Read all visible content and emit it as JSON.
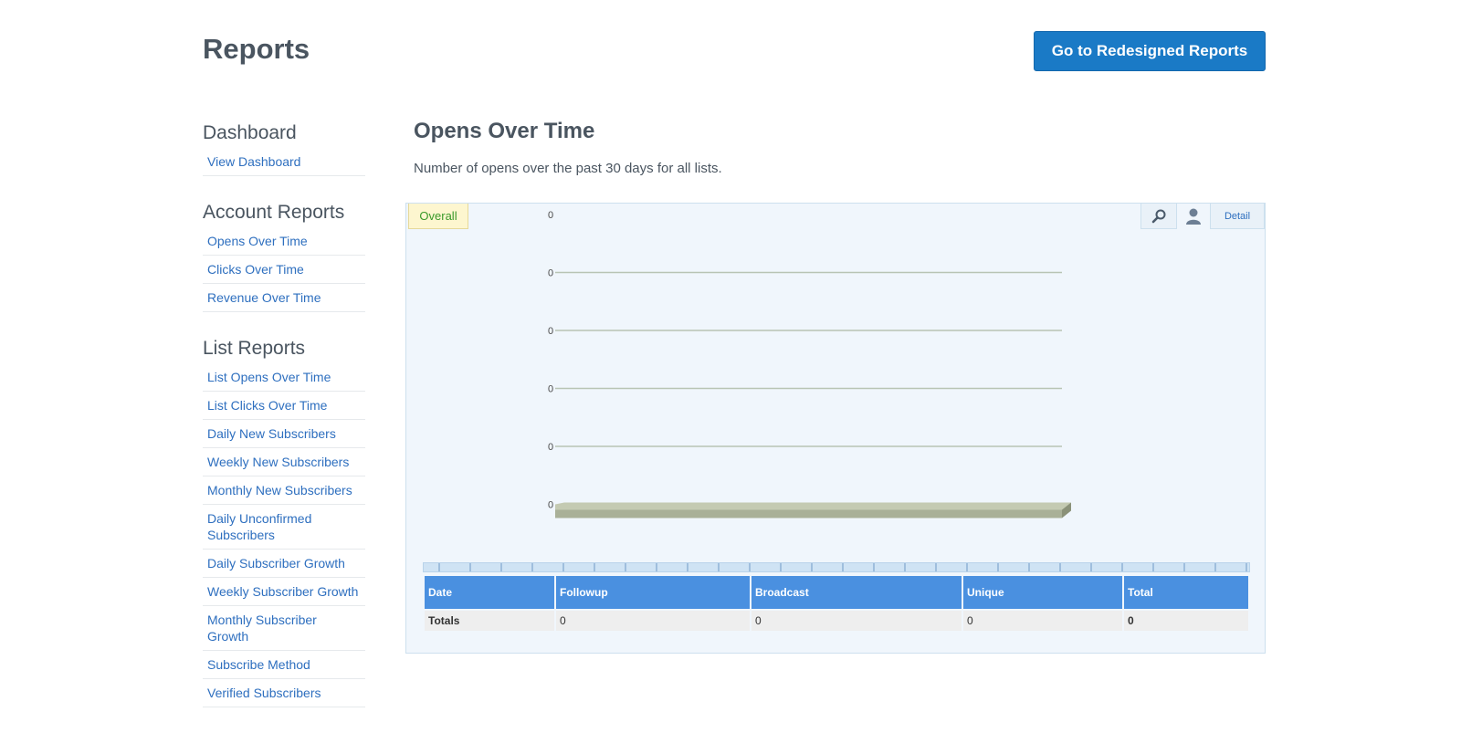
{
  "page": {
    "title": "Reports"
  },
  "header": {
    "redesign_button": "Go to Redesigned Reports"
  },
  "sidebar": {
    "sections": [
      {
        "heading": "Dashboard",
        "links": [
          "View Dashboard"
        ]
      },
      {
        "heading": "Account Reports",
        "links": [
          "Opens Over Time",
          "Clicks Over Time",
          "Revenue Over Time"
        ]
      },
      {
        "heading": "List Reports",
        "links": [
          "List Opens Over Time",
          "List Clicks Over Time",
          "Daily New Subscribers",
          "Weekly New Subscribers",
          "Monthly New Subscribers",
          "Daily Unconfirmed Subscribers",
          "Daily Subscriber Growth",
          "Weekly Subscriber Growth",
          "Monthly Subscriber Growth",
          "Subscribe Method",
          "Verified Subscribers"
        ]
      }
    ]
  },
  "main": {
    "title": "Opens Over Time",
    "description": "Number of opens over the past 30 days for all lists.",
    "tabs": {
      "overall": "Overall",
      "detail": "Detail"
    },
    "icons": {
      "zoom": "magnifier-icon",
      "user": "user-icon"
    }
  },
  "chart_data": {
    "type": "bar",
    "y_tick_labels": [
      "0",
      "0",
      "0",
      "0",
      "0",
      "0"
    ],
    "values": [
      0
    ],
    "ylim": [
      0,
      0
    ],
    "grid": true,
    "bar_color": "#a9b098"
  },
  "table": {
    "columns": [
      "Date",
      "Followup",
      "Broadcast",
      "Unique",
      "Total"
    ],
    "rows": [
      [
        "Totals",
        "0",
        "0",
        "0",
        "0"
      ]
    ]
  },
  "colors": {
    "accent": "#1a7ac6",
    "link": "#2e6fbf",
    "table_header": "#4a90e0"
  }
}
